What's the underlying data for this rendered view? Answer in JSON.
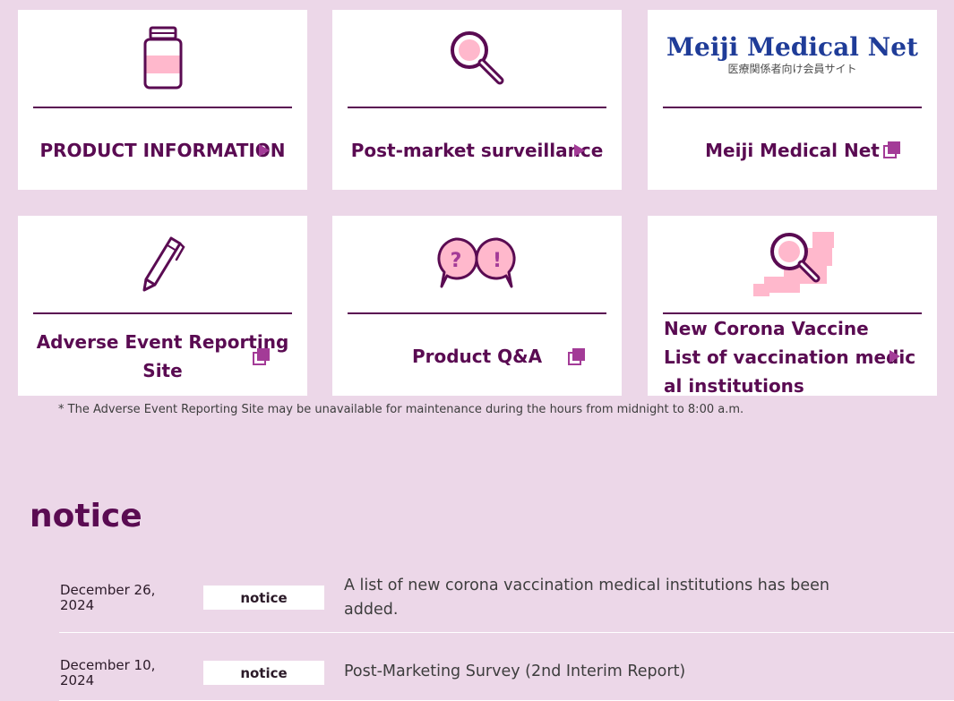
{
  "colors": {
    "background": "#ecd7e8",
    "card": "#ffffff",
    "primary": "#5a0b52",
    "accent": "#a33b97",
    "pink": "#ffb8cc"
  },
  "cards": [
    {
      "label": "PRODUCT INFORMATION",
      "icon": "vial-icon",
      "link_icon": "arrow-right-icon"
    },
    {
      "label": "Post-market surveillance",
      "icon": "magnifier-icon",
      "link_icon": "arrow-right-icon"
    },
    {
      "label": "Meiji Medical Net",
      "icon": "meiji-medical-net-logo",
      "logo_main": "Meiji Medical Net",
      "logo_sub": "医療関係者向け会員サイト",
      "link_icon": "external-link-icon"
    },
    {
      "label_line1": "Adverse Event Reporting",
      "label_line2": "Site",
      "icon": "pen-icon",
      "link_icon": "external-link-icon"
    },
    {
      "label": "Product Q&A",
      "icon": "question-exclamation-bubbles-icon",
      "link_icon": "external-link-icon"
    },
    {
      "label_line1": "New Corona Vaccine",
      "label_line2": "List of vaccination medic",
      "label_line3": "al institutions",
      "icon": "map-search-icon",
      "link_icon": "arrow-right-icon"
    }
  ],
  "maintenance_note": "* The Adverse Event Reporting Site may be unavailable for maintenance during the hours from midnight to 8:00 a.m.",
  "notice": {
    "title": "notice",
    "items": [
      {
        "date_line1": "December 26,",
        "date_line2": "2024",
        "badge": "notice",
        "text": "A list of new corona vaccination medical institutions has been added."
      },
      {
        "date_line1": "December 10,",
        "date_line2": "2024",
        "badge": "notice",
        "text": "Post-Marketing Survey (2nd Interim Report)"
      }
    ]
  }
}
